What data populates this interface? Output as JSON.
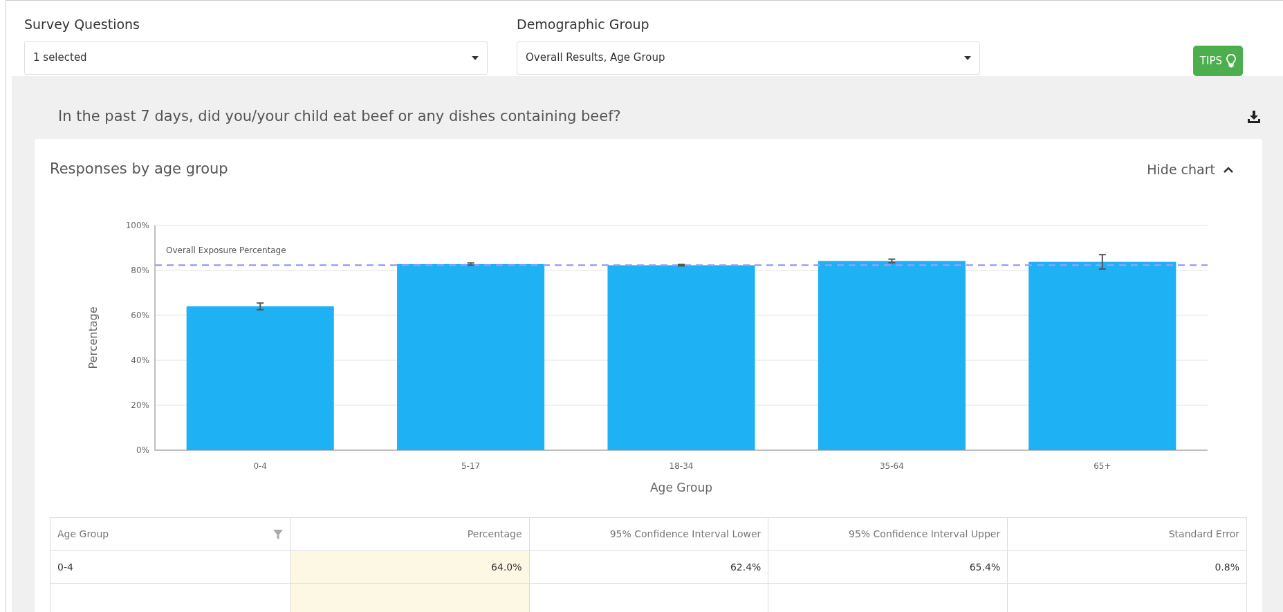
{
  "filters": [
    {
      "label": "Survey Questions",
      "value": "1 selected"
    },
    {
      "label": "Demographic Group",
      "value": "Overall Results, Age Group"
    }
  ],
  "tips_button": {
    "label": "TIPS"
  },
  "question": {
    "text": "In the past 7 days, did you/your child eat beef or any dishes containing beef?"
  },
  "card": {
    "title": "Responses by age group",
    "toggle_label": "Hide chart",
    "expanded": true,
    "chart_data": {
      "type": "bar",
      "xlabel": "Age Group",
      "ylabel": "Percentage",
      "grid": true,
      "categories": [
        "0-4",
        "5-17",
        "18-34",
        "35-64",
        "65+"
      ],
      "series": [
        {
          "color": "#1eb1f3",
          "values": [
            64.0,
            82.8,
            82.3,
            84.2,
            83.8
          ],
          "errors": [
            1.5,
            0.5,
            0.3,
            0.8,
            3.2
          ]
        }
      ],
      "ylim": [
        0,
        100
      ],
      "yticks": [
        {
          "value": 0,
          "label": "0%"
        },
        {
          "value": 20,
          "label": "20%"
        },
        {
          "value": 40,
          "label": "40%"
        },
        {
          "value": 60,
          "label": "60%"
        },
        {
          "value": 80,
          "label": "80%"
        },
        {
          "value": 100,
          "label": "100%"
        }
      ],
      "ref_lines": [
        {
          "axis": "y",
          "value": 82.3,
          "label": "Overall Exposure Percentage",
          "color": "#9c9cff"
        }
      ]
    }
  },
  "table": {
    "columns": [
      {
        "label": "Age Group",
        "filter": true,
        "highlighted": false
      },
      {
        "label": "Percentage",
        "filter": false,
        "highlighted": true
      },
      {
        "label": "95% Confidence Interval Lower",
        "filter": false,
        "highlighted": false
      },
      {
        "label": "95% Confidence Interval Upper",
        "filter": false,
        "highlighted": false
      },
      {
        "label": "Standard Error",
        "filter": false,
        "highlighted": false
      }
    ],
    "rows": [
      [
        "0-4",
        "64.0%",
        "62.4%",
        "65.4%",
        "0.8%"
      ]
    ]
  }
}
